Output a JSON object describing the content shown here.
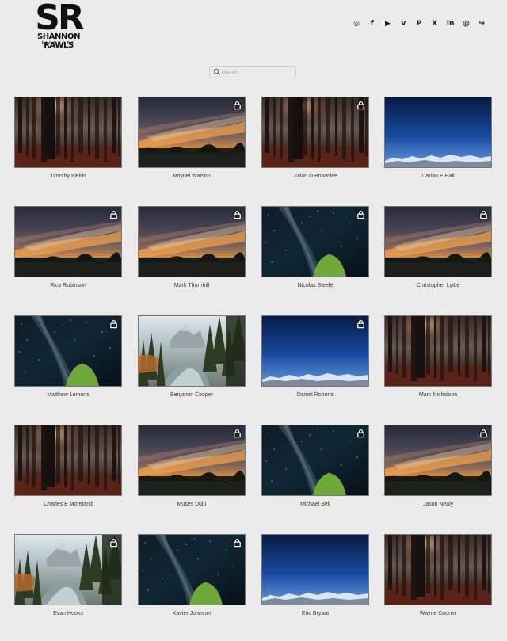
{
  "brand": {
    "monogram": "SR",
    "name": "SHANNON RAWLS",
    "tagline": "PICTURES"
  },
  "social": [
    {
      "name": "instagram",
      "glyph": "◎"
    },
    {
      "name": "facebook",
      "glyph": "f"
    },
    {
      "name": "youtube",
      "glyph": "▶"
    },
    {
      "name": "vimeo",
      "glyph": "v"
    },
    {
      "name": "pinterest",
      "glyph": "P"
    },
    {
      "name": "x",
      "glyph": "X"
    },
    {
      "name": "linkedin",
      "glyph": "in"
    },
    {
      "name": "threads",
      "glyph": "@"
    },
    {
      "name": "share",
      "glyph": "↪"
    }
  ],
  "search": {
    "placeholder": "Search",
    "value": ""
  },
  "gallery": [
    {
      "name": "Timothy Fields",
      "image": "forest",
      "locked": false
    },
    {
      "name": "Roynel Watson",
      "image": "sunset",
      "locked": true
    },
    {
      "name": "Julian D Brownlee",
      "image": "forest",
      "locked": true
    },
    {
      "name": "Darian E Hall",
      "image": "mountains",
      "locked": false
    },
    {
      "name": "Rico Robinson",
      "image": "sunset",
      "locked": true
    },
    {
      "name": "Mark Thornhill",
      "image": "sunset",
      "locked": true
    },
    {
      "name": "Nicolas Steele",
      "image": "milkyway",
      "locked": true
    },
    {
      "name": "Christopher Lyttle",
      "image": "sunset",
      "locked": true
    },
    {
      "name": "Matthew Lemons",
      "image": "milkyway",
      "locked": true
    },
    {
      "name": "Benjamin Cooper",
      "image": "river",
      "locked": false
    },
    {
      "name": "Daniel Roberts",
      "image": "mountains",
      "locked": true
    },
    {
      "name": "Mark Nicholson",
      "image": "forest",
      "locked": false
    },
    {
      "name": "Charles E Moreland",
      "image": "forest",
      "locked": false
    },
    {
      "name": "Muses Dulu",
      "image": "sunset",
      "locked": true
    },
    {
      "name": "Michael Bell",
      "image": "milkyway",
      "locked": true
    },
    {
      "name": "Jason Nealy",
      "image": "sunset",
      "locked": true
    },
    {
      "name": "Evan Hooks",
      "image": "river",
      "locked": true
    },
    {
      "name": "Xavier Johnson",
      "image": "milkyway",
      "locked": true
    },
    {
      "name": "Eric Bryant",
      "image": "mountains",
      "locked": false
    },
    {
      "name": "Wayne Codner",
      "image": "forest",
      "locked": false
    }
  ]
}
